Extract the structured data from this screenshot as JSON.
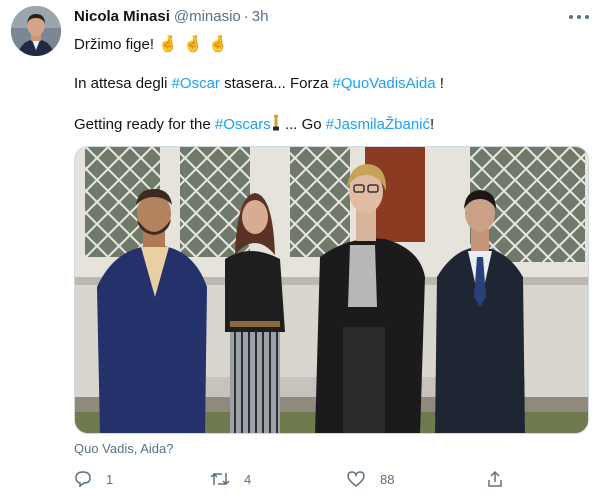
{
  "tweet": {
    "author": {
      "display_name": "Nicola Minasi",
      "handle": "@minasio",
      "time": "3h"
    },
    "line1": {
      "text": "Držimo fige!",
      "emoji": "🤞 🤞 🤞"
    },
    "line2": {
      "prefix": "In attesa degli ",
      "tag1": "#Oscar",
      "middle": " stasera... Forza ",
      "tag2": "#QuoVadisAida",
      "suffix": " !"
    },
    "line3": {
      "prefix": "Getting ready for the ",
      "tag1": "#Oscars",
      "middle": " ... Go ",
      "tag2": "#JasmilaŽbanić",
      "suffix": "!"
    },
    "media_caption": "Quo Vadis, Aida?",
    "actions": {
      "reply_count": "1",
      "retweet_count": "4",
      "like_count": "88"
    },
    "icons": [
      "more-icon",
      "reply-icon",
      "retweet-icon",
      "like-icon",
      "share-icon",
      "oscar-statuette-icon"
    ],
    "colors": {
      "link": "#1da1f2",
      "muted": "#5b7083",
      "text": "#0f1419"
    }
  }
}
